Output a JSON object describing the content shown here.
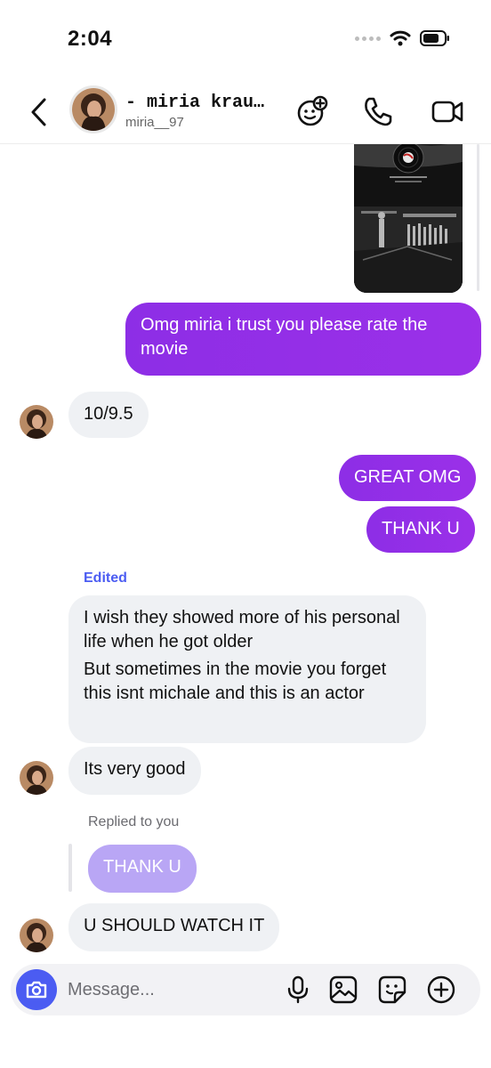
{
  "status_bar": {
    "time": "2:04"
  },
  "header": {
    "display_name": "- miria kraus...",
    "username": "miria__97"
  },
  "messages": [
    {
      "id": "m1",
      "type": "shared-reel"
    },
    {
      "id": "m2",
      "direction": "outgoing",
      "text": "Omg miria i trust you please rate the movie"
    },
    {
      "id": "m3",
      "direction": "incoming",
      "text": "10/9.5"
    },
    {
      "id": "m4",
      "direction": "outgoing",
      "text": "GREAT OMG"
    },
    {
      "id": "m5",
      "direction": "outgoing",
      "text": "THANK U"
    },
    {
      "id": "m6",
      "direction": "incoming",
      "edited_label": "Edited",
      "text": "I wish they showed more of his personal life when he got older",
      "text2": "But sometimes in the movie you forget this isnt michale and this is an actor"
    },
    {
      "id": "m7",
      "direction": "incoming",
      "text": "Its very good"
    },
    {
      "id": "m8",
      "direction": "incoming",
      "reply_label": "Replied to you",
      "quoted_text": "THANK U",
      "text": "U SHOULD WATCH IT"
    }
  ],
  "composer": {
    "placeholder": "Message..."
  },
  "colors": {
    "outgoing": "#9330e7",
    "incoming": "#eff1f4",
    "accent": "#4b5cf2",
    "edited": "#4b5cf2",
    "quoted": "#b9a6f5"
  },
  "icons": [
    "back-icon",
    "effects-icon",
    "phone-icon",
    "video-icon",
    "camera-icon",
    "microphone-icon",
    "gallery-icon",
    "sticker-icon",
    "plus-icon",
    "vinyl-record-icon"
  ]
}
